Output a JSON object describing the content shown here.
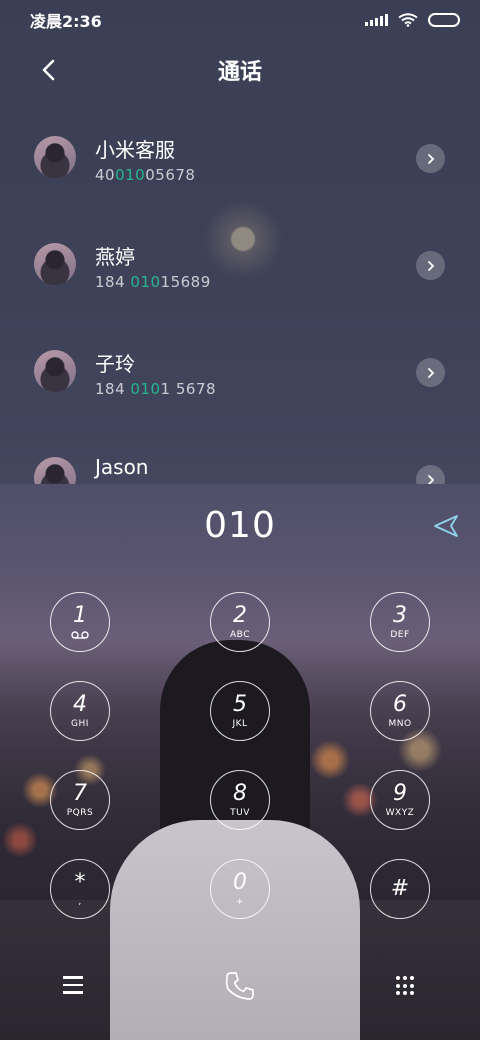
{
  "status_bar": {
    "time": "凌晨2:36"
  },
  "header": {
    "title": "通话"
  },
  "contacts": [
    {
      "name": "小米客服",
      "number_pre": "40",
      "number_match": "010",
      "number_post": "05678"
    },
    {
      "name": "燕婷",
      "number_pre": "184 ",
      "number_match": "010",
      "number_post": "15689"
    },
    {
      "name": "子玲",
      "number_pre": "184 ",
      "number_match": "010",
      "number_post": "1 5678"
    },
    {
      "name": "Jason",
      "number_pre": "",
      "number_match": "",
      "number_post": ""
    }
  ],
  "dialer": {
    "input": "010",
    "keys": [
      {
        "digit": "1",
        "letters": ""
      },
      {
        "digit": "2",
        "letters": "ABC"
      },
      {
        "digit": "3",
        "letters": "DEF"
      },
      {
        "digit": "4",
        "letters": "GHI"
      },
      {
        "digit": "5",
        "letters": "JKL"
      },
      {
        "digit": "6",
        "letters": "MNO"
      },
      {
        "digit": "7",
        "letters": "PQRS"
      },
      {
        "digit": "8",
        "letters": "TUV"
      },
      {
        "digit": "9",
        "letters": "WXYZ"
      },
      {
        "digit": "*",
        "letters": ","
      },
      {
        "digit": "0",
        "letters": "+"
      },
      {
        "digit": "#",
        "letters": ""
      }
    ]
  },
  "icons": {
    "back": "chevron-left-icon",
    "contact_detail": "chevron-right-icon",
    "send": "send-icon",
    "voicemail": "voicemail-icon",
    "menu": "menu-icon",
    "call": "phone-icon",
    "keypad": "keypad-icon"
  },
  "colors": {
    "match_highlight": "#27b58f"
  }
}
